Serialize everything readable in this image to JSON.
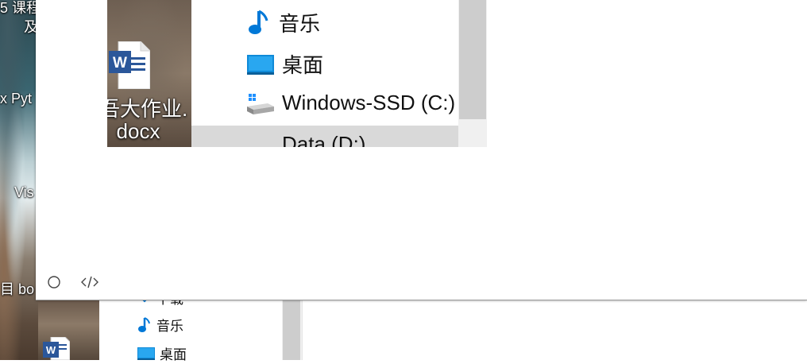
{
  "desktop": {
    "texts": [
      "5 课程",
      "及",
      "x Pyt",
      "Vis",
      "目 bo"
    ]
  },
  "overlay_shot": {
    "file": {
      "name_line1": "吾大作业.",
      "name_line2": "docx"
    },
    "nav_items": [
      {
        "label": "音乐",
        "icon": "music-note-icon"
      },
      {
        "label": "桌面",
        "icon": "desktop-icon"
      },
      {
        "label": "Windows-SSD (C:)",
        "icon": "drive-icon"
      },
      {
        "label": "Data (D:)",
        "icon": "drive-icon"
      }
    ]
  },
  "toolbar": {
    "buttons": [
      {
        "icon": "circle-icon"
      },
      {
        "icon": "code-icon"
      }
    ]
  },
  "background_explorer": {
    "nav_items": [
      {
        "label": "下载",
        "icon": "download-icon"
      },
      {
        "label": "音乐",
        "icon": "music-note-icon"
      },
      {
        "label": "桌面",
        "icon": "desktop-icon"
      }
    ]
  },
  "colors": {
    "accent": "#0078d7",
    "word_blue": "#2b579a",
    "scroll_thumb": "#cdcdcd",
    "selected": "#d9d9d9"
  }
}
